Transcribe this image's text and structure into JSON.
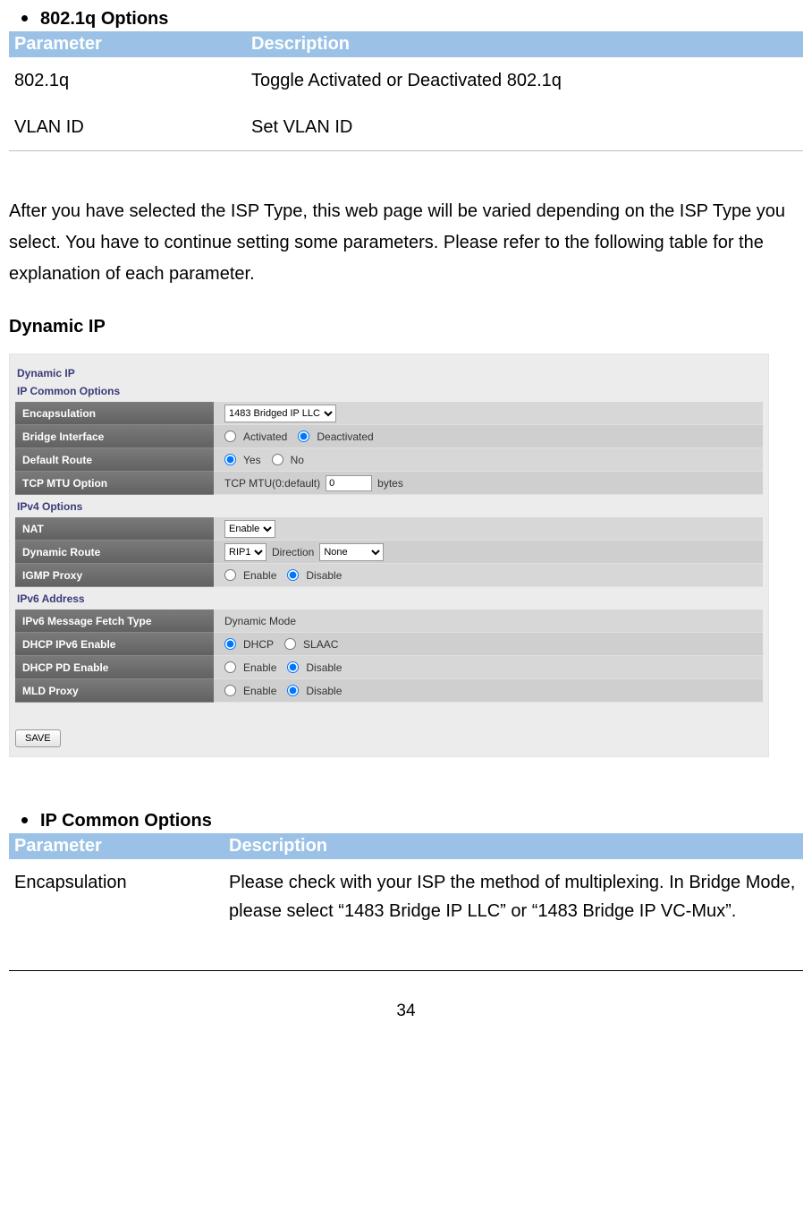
{
  "section1": {
    "title": "802.1q Options",
    "header": {
      "param": "Parameter",
      "desc": "Description"
    },
    "rows": [
      {
        "param": "802.1q",
        "desc": "Toggle Activated or Deactivated 802.1q"
      },
      {
        "param": "VLAN ID",
        "desc": "Set VLAN ID"
      }
    ]
  },
  "intro": "After you have selected the ISP Type, this web page will be varied depending on the ISP Type you select. You have to continue setting some parameters. Please refer to the following table for the explanation of each parameter.",
  "dynamic_ip_heading": "Dynamic IP",
  "ui": {
    "title": "Dynamic IP",
    "ip_common_title": "IP Common Options",
    "encapsulation": {
      "label": "Encapsulation",
      "value": "1483 Bridged IP LLC"
    },
    "bridge_interface": {
      "label": "Bridge Interface",
      "opt1": "Activated",
      "opt2": "Deactivated"
    },
    "default_route": {
      "label": "Default Route",
      "opt1": "Yes",
      "opt2": "No"
    },
    "tcp_mtu": {
      "label": "TCP MTU Option",
      "prefix": "TCP MTU(0:default)",
      "value": "0",
      "suffix": "bytes"
    },
    "ipv4_title": "IPv4 Options",
    "nat": {
      "label": "NAT",
      "value": "Enable"
    },
    "dynamic_route": {
      "label": "Dynamic Route",
      "value": "RIP1",
      "direction_label": "Direction",
      "direction_value": "None"
    },
    "igmp_proxy": {
      "label": "IGMP Proxy",
      "opt1": "Enable",
      "opt2": "Disable"
    },
    "ipv6_title": "IPv6 Address",
    "ipv6_fetch": {
      "label": "IPv6 Message Fetch Type",
      "value": "Dynamic Mode"
    },
    "dhcp_ipv6": {
      "label": "DHCP IPv6 Enable",
      "opt1": "DHCP",
      "opt2": "SLAAC"
    },
    "dhcp_pd": {
      "label": "DHCP PD Enable",
      "opt1": "Enable",
      "opt2": "Disable"
    },
    "mld_proxy": {
      "label": "MLD Proxy",
      "opt1": "Enable",
      "opt2": "Disable"
    },
    "save": "SAVE"
  },
  "section2": {
    "title": "IP Common Options",
    "header": {
      "param": "Parameter",
      "desc": "Description"
    },
    "rows": [
      {
        "param": "Encapsulation",
        "desc": "Please check with your ISP the method of multiplexing. In Bridge Mode, please select “1483 Bridge IP LLC” or “1483 Bridge IP VC-Mux”."
      }
    ]
  },
  "page_number": "34"
}
